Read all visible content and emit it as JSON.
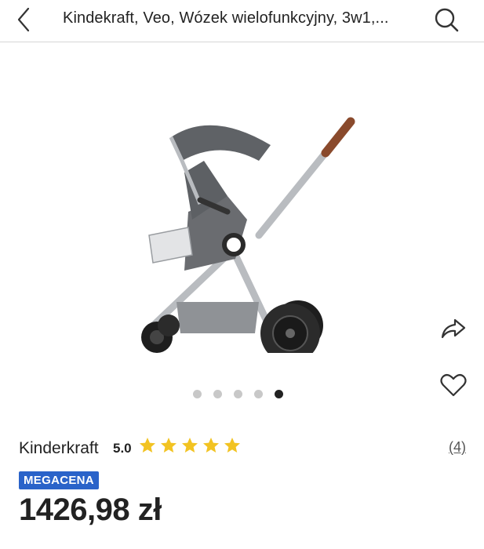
{
  "header": {
    "title": "Kindekraft, Veo, Wózek wielofunkcyjny, 3w1,...",
    "back_icon": "chevron-left-icon",
    "search_icon": "search-icon"
  },
  "gallery": {
    "image_subject": "stroller",
    "total_images": 5,
    "active_index": 4,
    "share_icon": "share-arrow-icon",
    "favorite_icon": "heart-outline-icon"
  },
  "product": {
    "brand": "Kinderkraft",
    "rating_value": "5.0",
    "rating_stars": 5,
    "review_count": "(4)",
    "badge": "MEGACENA",
    "price": "1426,98 zł"
  },
  "colors": {
    "accent": "#2a63c9",
    "star": "#f2c322",
    "dot_inactive": "#c8c8c8",
    "dot_active": "#222222",
    "text": "#222222"
  }
}
